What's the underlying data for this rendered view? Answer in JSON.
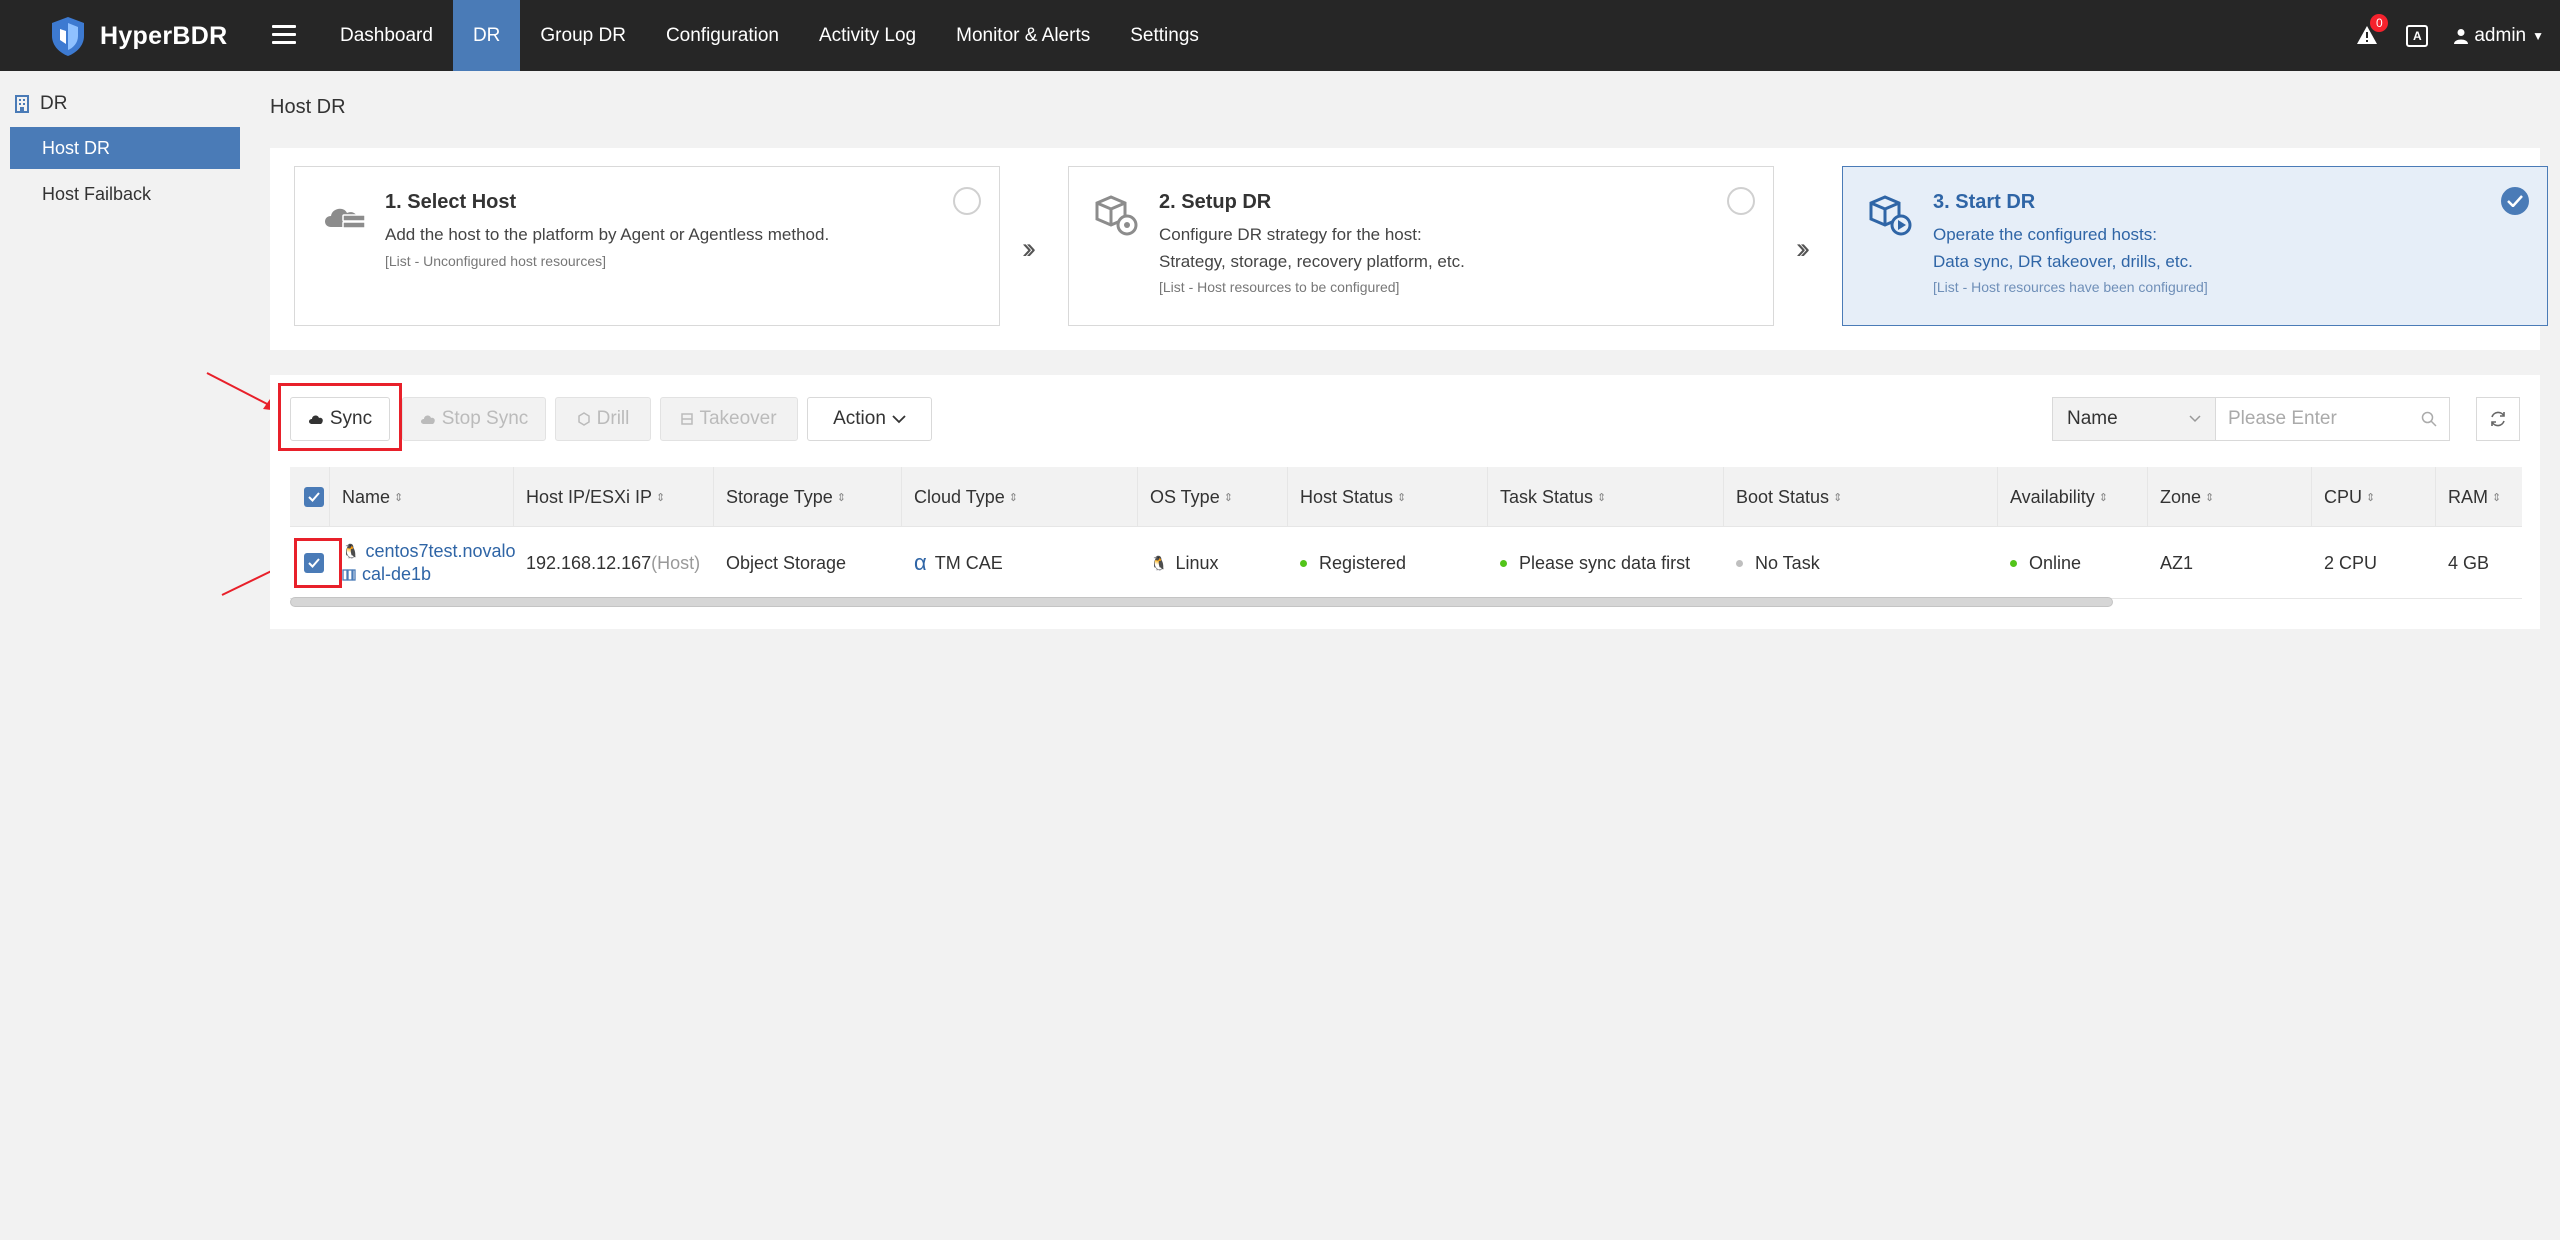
{
  "app": {
    "name": "HyperBDR",
    "nav": [
      "Dashboard",
      "DR",
      "Group DR",
      "Configuration",
      "Activity Log",
      "Monitor & Alerts",
      "Settings"
    ],
    "active_nav": "DR",
    "alert_count": "0",
    "lang_icon": "A",
    "user": "admin"
  },
  "sidebar": {
    "section": "DR",
    "items": [
      {
        "label": "Host DR",
        "active": true
      },
      {
        "label": "Host Failback",
        "active": false
      }
    ]
  },
  "page": {
    "title": "Host DR"
  },
  "steps": [
    {
      "title": "1. Select Host",
      "desc_lines": [
        "Add the host to the platform by Agent or Agentless method."
      ],
      "note": "[List - Unconfigured host resources]",
      "checked": false
    },
    {
      "title": "2. Setup DR",
      "desc_lines": [
        "Configure DR strategy for the host:",
        "Strategy, storage, recovery platform, etc."
      ],
      "note": "[List - Host resources to be configured]",
      "checked": false
    },
    {
      "title": "3. Start DR",
      "desc_lines": [
        "Operate the configured hosts:",
        "Data sync, DR takeover, drills, etc."
      ],
      "note": "[List - Host resources have been configured]",
      "checked": true
    }
  ],
  "toolbar": {
    "sync": "Sync",
    "stop_sync": "Stop Sync",
    "drill": "Drill",
    "takeover": "Takeover",
    "action": "Action",
    "search_field": "Name",
    "search_placeholder": "Please Enter"
  },
  "table": {
    "columns": [
      "Name",
      "Host IP/ESXi IP",
      "Storage Type",
      "Cloud Type",
      "OS Type",
      "Host Status",
      "Task Status",
      "Boot Status",
      "Availability",
      "Zone",
      "CPU",
      "RAM"
    ],
    "rows": [
      {
        "name_line1": "centos7test.novalo",
        "name_line2": "cal-de1b",
        "ip": "192.168.12.167",
        "ip_suffix": "(Host)",
        "storage": "Object Storage",
        "cloud_icon": "α",
        "cloud": "TM CAE",
        "os": "Linux",
        "host_status": "Registered",
        "task_status": "Please sync data first",
        "boot_status": "No Task",
        "availability": "Online",
        "zone": "AZ1",
        "cpu": "2 CPU",
        "ram": "4 GB"
      }
    ]
  },
  "colors": {
    "accent": "#4a7bb7",
    "topbar": "#262626",
    "status_green": "#52c41a",
    "status_gray": "#bfbfbf",
    "highlight_red": "#e8202a"
  }
}
